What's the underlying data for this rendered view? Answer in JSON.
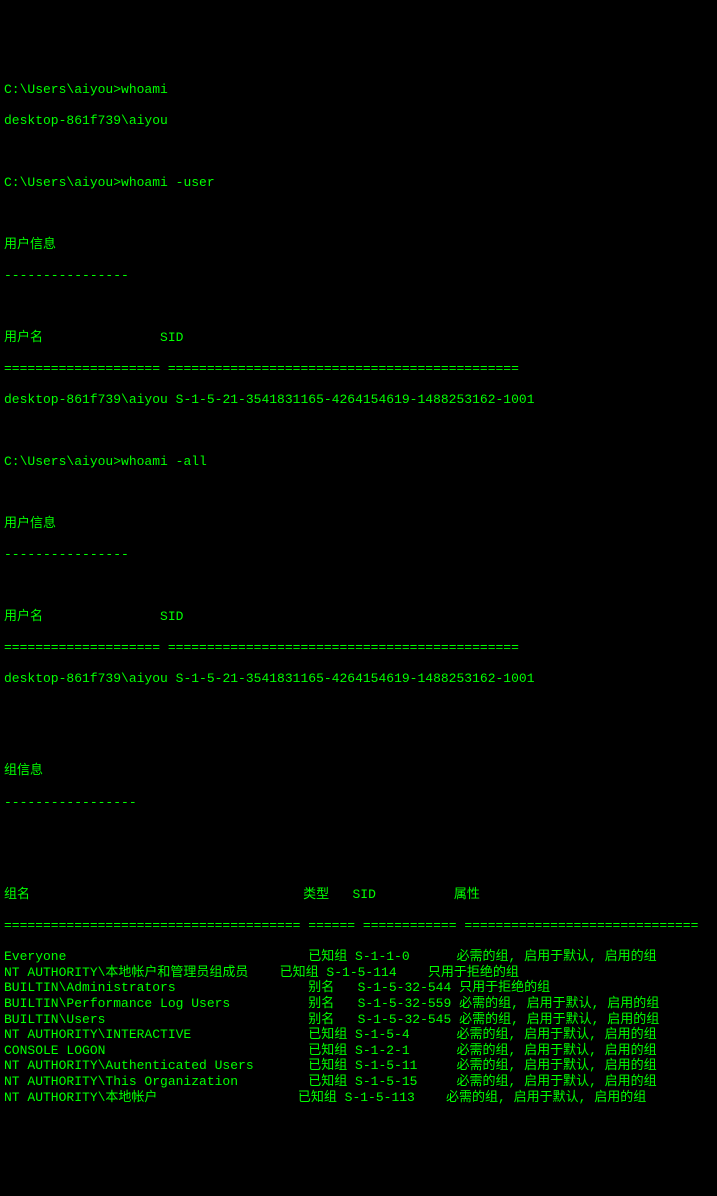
{
  "cmd1": {
    "prompt": "C:\\Users\\aiyou>",
    "command": "whoami",
    "output": "desktop-861f739\\aiyou"
  },
  "cmd2": {
    "prompt": "C:\\Users\\aiyou>",
    "command": "whoami -user",
    "header": "用户信息",
    "sep1": "----------------",
    "col_user": "用户名",
    "col_sid": "SID",
    "sep_col1": "====================",
    "sep_col2": "=============================================",
    "user": "desktop-861f739\\aiyou",
    "sid": "S-1-5-21-3541831165-4264154619-1488253162-1001"
  },
  "cmd3": {
    "prompt": "C:\\Users\\aiyou>",
    "command": "whoami -all",
    "header1": "用户信息",
    "sep1": "----------------",
    "col_user": "用户名",
    "col_sid": "SID",
    "sep_col1": "====================",
    "sep_col2": "=============================================",
    "user": "desktop-861f739\\aiyou",
    "sid": "S-1-5-21-3541831165-4264154619-1488253162-1001",
    "header2": "组信息",
    "sep2": "-----------------",
    "gcol_name": "组名",
    "gcol_type": "类型",
    "gcol_sid": "SID",
    "gcol_attr": "属性",
    "gsep1": "======================================",
    "gsep2": "======",
    "gsep3": "============",
    "gsep4": "==============================",
    "groups": [
      {
        "name": "Everyone",
        "type": "已知组",
        "sid": "S-1-1-0",
        "attr": "必需的组, 启用于默认, 启用的组"
      },
      {
        "name": "NT AUTHORITY\\本地帐户和管理员组成员",
        "type": "已知组",
        "sid": "S-1-5-114",
        "attr": "只用于拒绝的组"
      },
      {
        "name": "BUILTIN\\Administrators",
        "type": "别名",
        "sid": "S-1-5-32-544",
        "attr": "只用于拒绝的组"
      },
      {
        "name": "BUILTIN\\Performance Log Users",
        "type": "别名",
        "sid": "S-1-5-32-559",
        "attr": "必需的组, 启用于默认, 启用的组"
      },
      {
        "name": "BUILTIN\\Users",
        "type": "别名",
        "sid": "S-1-5-32-545",
        "attr": "必需的组, 启用于默认, 启用的组"
      },
      {
        "name": "NT AUTHORITY\\INTERACTIVE",
        "type": "已知组",
        "sid": "S-1-5-4",
        "attr": "必需的组, 启用于默认, 启用的组"
      },
      {
        "name": "CONSOLE LOGON",
        "type": "已知组",
        "sid": "S-1-2-1",
        "attr": "必需的组, 启用于默认, 启用的组"
      },
      {
        "name": "NT AUTHORITY\\Authenticated Users",
        "type": "已知组",
        "sid": "S-1-5-11",
        "attr": "必需的组, 启用于默认, 启用的组"
      },
      {
        "name": "NT AUTHORITY\\This Organization",
        "type": "已知组",
        "sid": "S-1-5-15",
        "attr": "必需的组, 启用于默认, 启用的组"
      },
      {
        "name": "NT AUTHORITY\\本地帐户",
        "type": "已知组",
        "sid": "S-1-5-113",
        "attr": "必需的组, 启用于默认, 启用的组"
      }
    ]
  }
}
